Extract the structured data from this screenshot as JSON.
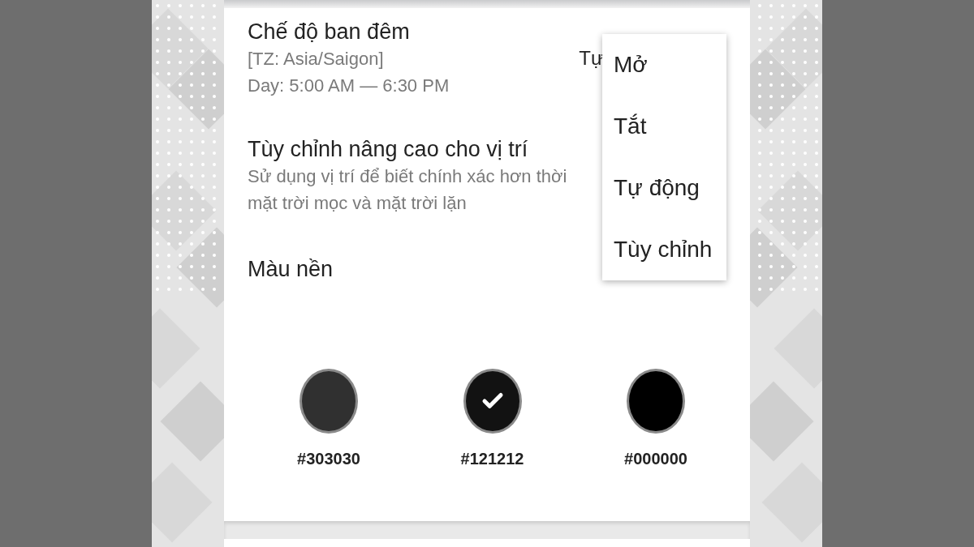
{
  "settings": [
    {
      "kind": "value",
      "title": "Chế độ ban đêm",
      "lines": [
        "[TZ: Asia/Saigon]",
        "Day: 5:00 AM — 6:30 PM"
      ],
      "value": "Tự"
    },
    {
      "kind": "summary",
      "title": "Tùy chỉnh nâng cao cho vị trí",
      "lines": [
        "Sử dụng vị trí để biết chính xác hơn thời",
        "mặt trời mọc và mặt trời lặn"
      ]
    }
  ],
  "background_color": {
    "title": "Màu nền",
    "swatches": [
      {
        "label": "#303030",
        "color": "#303030",
        "selected": false
      },
      {
        "label": "#121212",
        "color": "#121212",
        "selected": true
      },
      {
        "label": "#000000",
        "color": "#000000",
        "selected": false
      }
    ]
  },
  "popup_menu": {
    "items": [
      {
        "label": "Mở"
      },
      {
        "label": "Tắt"
      },
      {
        "label": "Tự động"
      },
      {
        "label": "Tùy chỉnh"
      }
    ]
  }
}
